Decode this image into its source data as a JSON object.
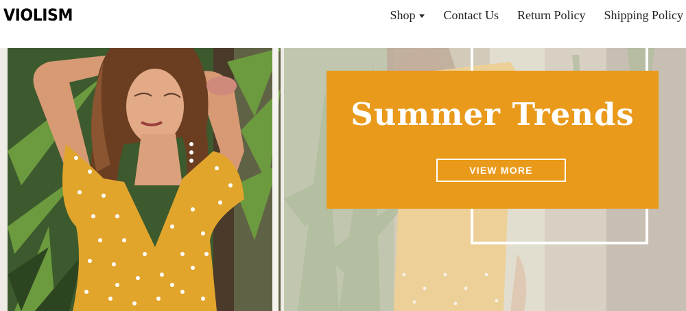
{
  "brand": {
    "logo_text": "VIOLISM"
  },
  "nav": {
    "items": [
      {
        "label": "Shop",
        "has_dropdown": true
      },
      {
        "label": "Contact Us",
        "has_dropdown": false
      },
      {
        "label": "Return Policy",
        "has_dropdown": false
      },
      {
        "label": "Shipping Policy",
        "has_dropdown": false
      }
    ],
    "dropdown_icon": "caret-down-icon"
  },
  "hero": {
    "title": "Summer Trends",
    "button_label": "VIEW MORE",
    "accent_color": "#e99a1b",
    "dress_color": "#e2a52c"
  }
}
